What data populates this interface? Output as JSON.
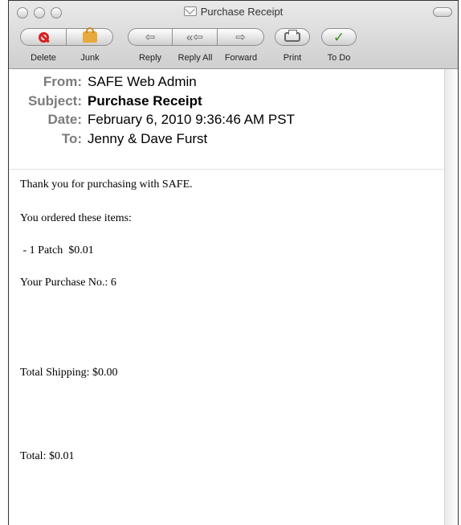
{
  "window": {
    "title": "Purchase Receipt"
  },
  "toolbar": {
    "delete_label": "Delete",
    "junk_label": "Junk",
    "reply_label": "Reply",
    "reply_all_label": "Reply All",
    "forward_label": "Forward",
    "print_label": "Print",
    "todo_label": "To Do"
  },
  "header": {
    "from_label": "From:",
    "from_value": "SAFE Web Admin",
    "subject_label": "Subject:",
    "subject_value": "Purchase Receipt",
    "date_label": "Date:",
    "date_value": "February 6, 2010 9:36:46 AM PST",
    "to_label": "To:",
    "to_value": "Jenny & Dave Furst"
  },
  "body": {
    "line1": "Thank you for purchasing with SAFE.",
    "line2": "You ordered these items:",
    "line3": " - 1 Patch  $0.01",
    "line4": "Your Purchase No.: 6",
    "line5": "Total Shipping: $0.00",
    "line6": "Total: $0.01"
  },
  "colors": {
    "header_label": "#7b7b7b",
    "delete_icon": "#d62020",
    "junk_icon": "#e8a93c",
    "todo_icon": "#3a8d1a"
  }
}
